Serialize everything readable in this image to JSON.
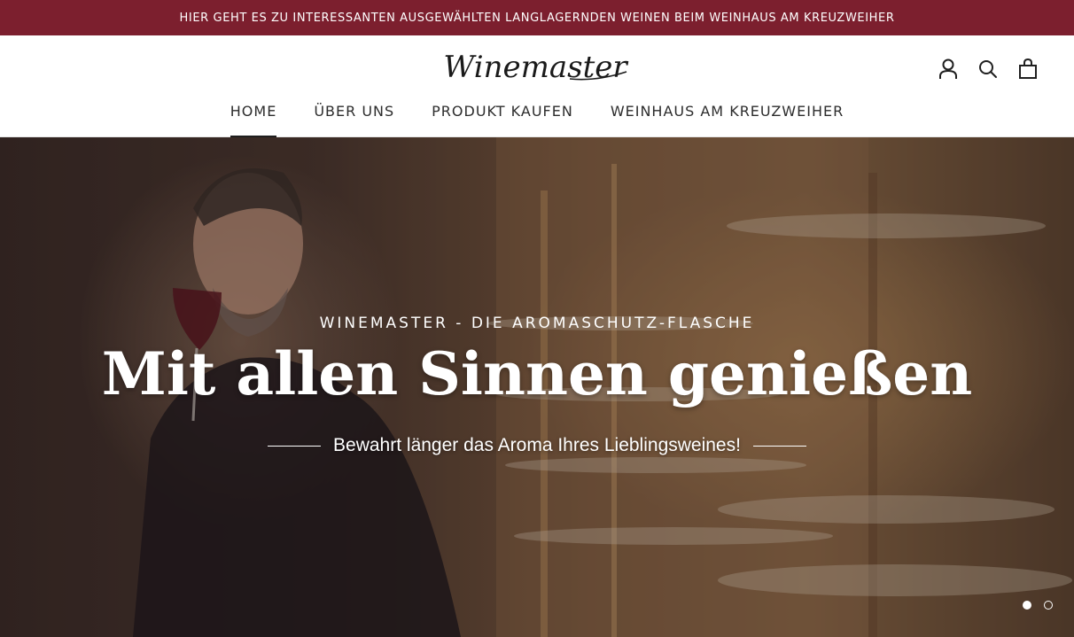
{
  "announcement": {
    "text": "HIER GEHT ES ZU INTERESSANTEN AUSGEWÄHLTEN LANGLAGERNDEN WEINEN BEIM WEINHAUS AM KREUZWEIHER",
    "background_color": "#7c1f2e"
  },
  "header": {
    "logo_text": "Winemaster",
    "icons": [
      "account-icon",
      "search-icon",
      "cart-icon"
    ]
  },
  "nav": {
    "items": [
      {
        "label": "HOME",
        "active": true
      },
      {
        "label": "ÜBER UNS",
        "active": false
      },
      {
        "label": "PRODUKT KAUFEN",
        "active": false
      },
      {
        "label": "WEINHAUS AM KREUZWEIHER",
        "active": false
      }
    ]
  },
  "hero": {
    "subheading": "WINEMASTER - DIE AROMASCHUTZ-FLASCHE",
    "title": "Mit allen Sinnen genießen",
    "tagline": "Bewahrt länger das Aroma Ihres Lieblingsweines!",
    "slide_count": 2,
    "active_slide": 1
  }
}
